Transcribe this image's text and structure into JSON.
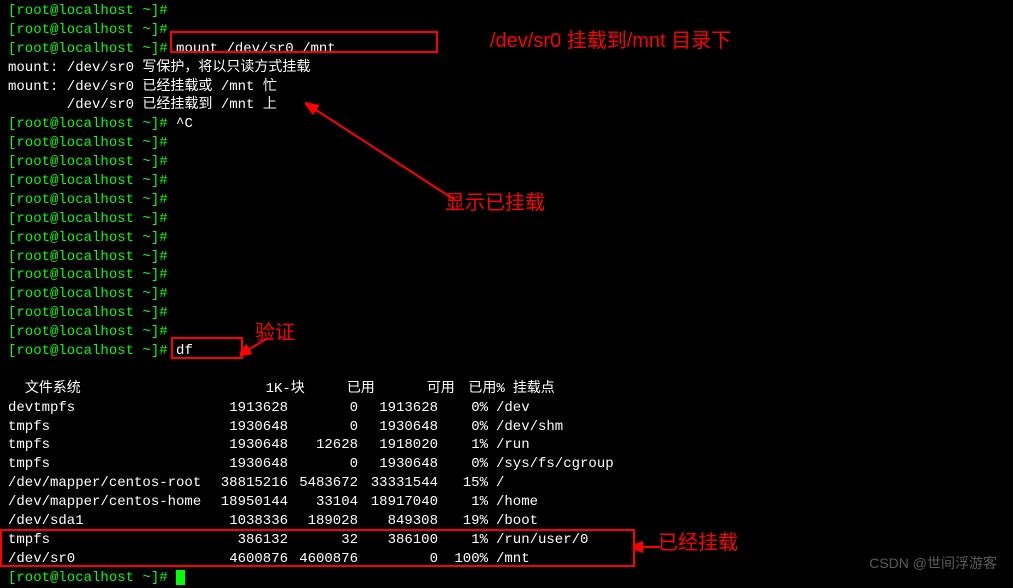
{
  "prompt": "[root@localhost ~]#",
  "cmd_mount": "mount /dev/sr0 /mnt",
  "mount_out": {
    "l1": "mount: /dev/sr0 写保护，将以只读方式挂载",
    "l2": "mount: /dev/sr0 已经挂载或 /mnt 忙",
    "l3": "       /dev/sr0 已经挂载到 /mnt 上"
  },
  "ctrl_c": "^C",
  "cmd_df": "df",
  "annotations": {
    "mount_note": "/dev/sr0 挂载到/mnt 目录下",
    "mounted_note": "显示已挂载",
    "verify": "验证",
    "already_mounted": "已经挂载"
  },
  "df": {
    "header": {
      "fs": "文件系统",
      "blocks": "1K-块",
      "used": "已用",
      "avail": "可用",
      "pct": "已用%",
      "mnt": "挂载点"
    },
    "rows": [
      {
        "fs": "devtmpfs",
        "blocks": "1913628",
        "used": "0",
        "avail": "1913628",
        "pct": "0%",
        "mnt": "/dev"
      },
      {
        "fs": "tmpfs",
        "blocks": "1930648",
        "used": "0",
        "avail": "1930648",
        "pct": "0%",
        "mnt": "/dev/shm"
      },
      {
        "fs": "tmpfs",
        "blocks": "1930648",
        "used": "12628",
        "avail": "1918020",
        "pct": "1%",
        "mnt": "/run"
      },
      {
        "fs": "tmpfs",
        "blocks": "1930648",
        "used": "0",
        "avail": "1930648",
        "pct": "0%",
        "mnt": "/sys/fs/cgroup"
      },
      {
        "fs": "/dev/mapper/centos-root",
        "blocks": "38815216",
        "used": "5483672",
        "avail": "33331544",
        "pct": "15%",
        "mnt": "/"
      },
      {
        "fs": "/dev/mapper/centos-home",
        "blocks": "18950144",
        "used": "33104",
        "avail": "18917040",
        "pct": "1%",
        "mnt": "/home"
      },
      {
        "fs": "/dev/sda1",
        "blocks": "1038336",
        "used": "189028",
        "avail": "849308",
        "pct": "19%",
        "mnt": "/boot"
      },
      {
        "fs": "tmpfs",
        "blocks": "386132",
        "used": "32",
        "avail": "386100",
        "pct": "1%",
        "mnt": "/run/user/0"
      },
      {
        "fs": "/dev/sr0",
        "blocks": "4600876",
        "used": "4600876",
        "avail": "0",
        "pct": "100%",
        "mnt": "/mnt"
      }
    ]
  },
  "watermark": "CSDN @世间浮游客"
}
